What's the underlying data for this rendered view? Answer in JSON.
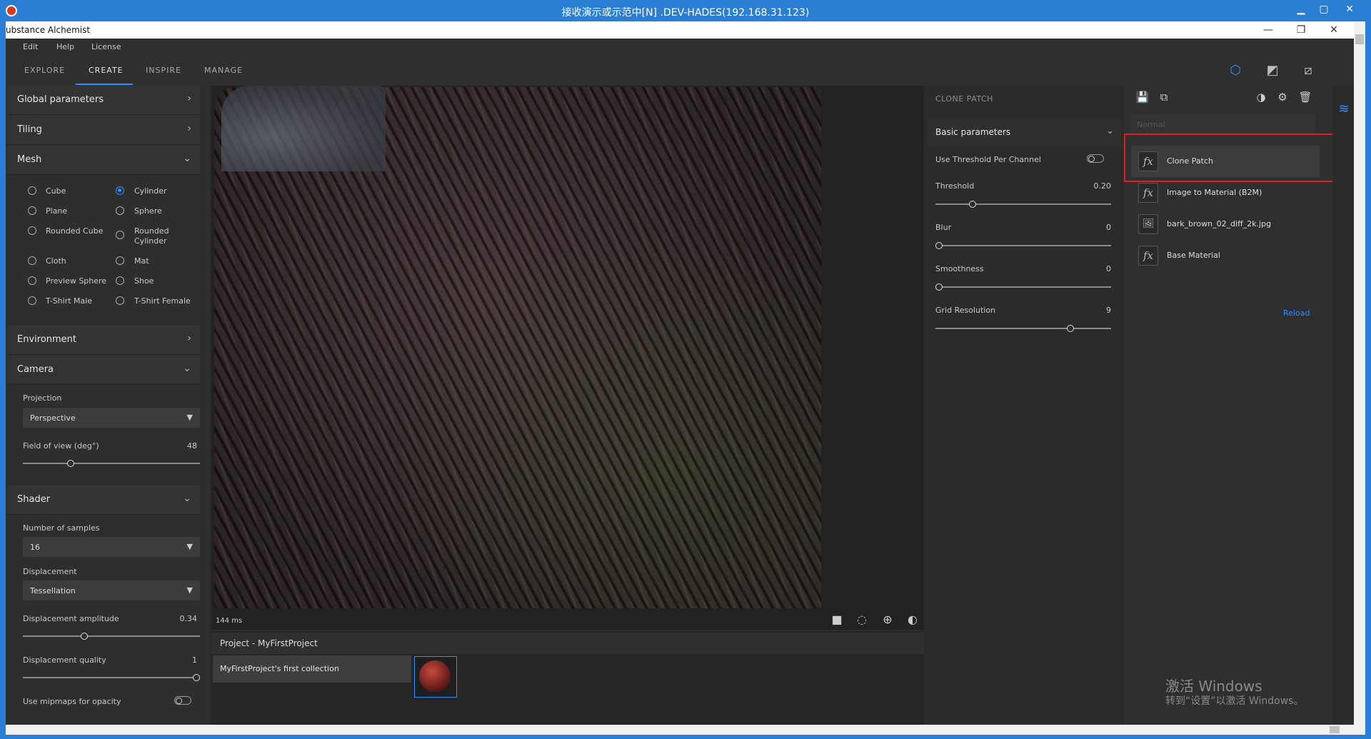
{
  "remote_title": "接收演示或示范中[N] .DEV-HADES(192.168.31.123)",
  "remote_controls": {
    "minimize": "▁",
    "maximize": "▢",
    "close": "✕"
  },
  "app_title": "ubstance Alchemist",
  "window_controls": {
    "minimize": "—",
    "restore": "❐",
    "close": "✕"
  },
  "menu": [
    "Edit",
    "Help",
    "License"
  ],
  "tabs": [
    {
      "label": "EXPLORE",
      "active": false
    },
    {
      "label": "CREATE",
      "active": true
    },
    {
      "label": "INSPIRE",
      "active": false
    },
    {
      "label": "MANAGE",
      "active": false
    }
  ],
  "toolbar_icons": [
    "cube-view-icon",
    "2d-view-icon",
    "split-view-icon"
  ],
  "left_panel": {
    "global_parameters": "Global parameters",
    "tiling": "Tiling",
    "mesh": {
      "label": "Mesh",
      "options": [
        {
          "label": "Cube",
          "selected": false
        },
        {
          "label": "Cylinder",
          "selected": true
        },
        {
          "label": "Plane",
          "selected": false
        },
        {
          "label": "Sphere",
          "selected": false
        },
        {
          "label": "Rounded Cube",
          "selected": false
        },
        {
          "label": "Rounded Cylinder",
          "selected": false
        },
        {
          "label": "Cloth",
          "selected": false
        },
        {
          "label": "Mat",
          "selected": false
        },
        {
          "label": "Preview Sphere",
          "selected": false
        },
        {
          "label": "Shoe",
          "selected": false
        },
        {
          "label": "T-Shirt Male",
          "selected": false
        },
        {
          "label": "T-Shirt Female",
          "selected": false
        }
      ]
    },
    "environment": "Environment",
    "camera": {
      "label": "Camera",
      "projection_label": "Projection",
      "projection_value": "Perspective",
      "fov_label": "Field of view (deg°)",
      "fov_value": "48",
      "fov_fraction": 0.26
    },
    "shader": {
      "label": "Shader",
      "samples_label": "Number of samples",
      "samples_value": "16",
      "displacement_label": "Displacement",
      "displacement_value": "Tessellation",
      "amp_label": "Displacement amplitude",
      "amp_value": "0.34",
      "amp_fraction": 0.34,
      "quality_label": "Displacement quality",
      "quality_value": "1",
      "quality_fraction": 1.0,
      "mipmaps_label": "Use mipmaps for opacity",
      "mipmaps_on": false
    }
  },
  "viewport": {
    "timing": "144 ms",
    "icons": [
      "camera-icon",
      "rotate-light-icon",
      "environment-icon",
      "material-ball-icon"
    ]
  },
  "project": {
    "title": "Project - MyFirstProject",
    "collection": "MyFirstProject's first collection"
  },
  "properties": {
    "title": "CLONE PATCH",
    "section": "Basic parameters",
    "threshold_per_channel_label": "Use Threshold Per Channel",
    "threshold_per_channel_on": false,
    "params": [
      {
        "label": "Threshold",
        "value": "0.20",
        "fraction": 0.2
      },
      {
        "label": "Blur",
        "value": "0",
        "fraction": 0.0
      },
      {
        "label": "Smoothness",
        "value": "0",
        "fraction": 0.0
      },
      {
        "label": "Grid Resolution",
        "value": "9",
        "fraction": 0.78
      }
    ]
  },
  "stack": {
    "toolbar_icons": [
      "save-icon",
      "add-layer-icon",
      "mask-icon",
      "settings-icon",
      "delete-icon"
    ],
    "channel": "Normal",
    "layers": [
      {
        "label": "Clone Patch",
        "icon": "fx",
        "selected": true
      },
      {
        "label": "Image to Material (B2M)",
        "icon": "fx",
        "selected": false
      },
      {
        "label": "bark_brown_02_diff_2k.jpg",
        "icon": "🖼",
        "selected": false
      },
      {
        "label": "Base Material",
        "icon": "fx",
        "selected": false
      }
    ],
    "reload": "Reload"
  },
  "watermark": {
    "line1": "激活 Windows",
    "line2": "转到“设置”以激活 Windows。"
  }
}
